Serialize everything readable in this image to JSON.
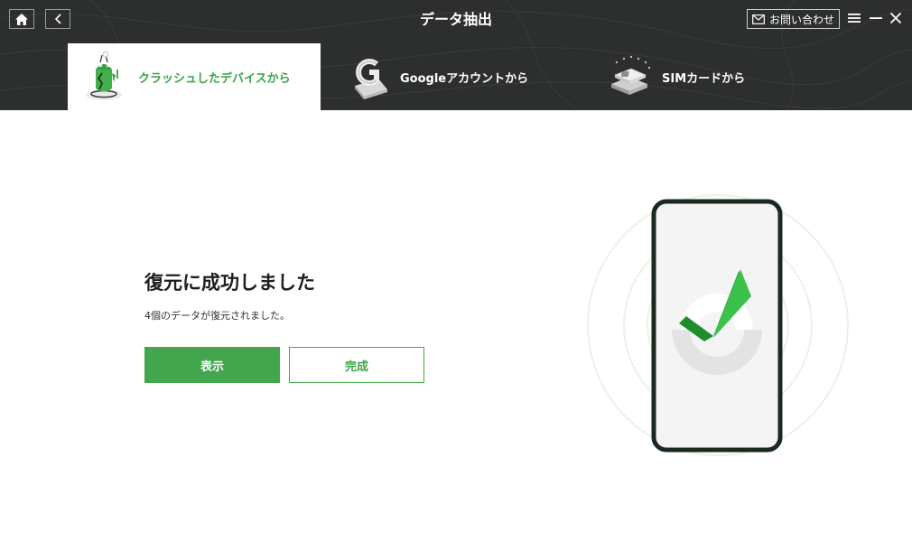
{
  "window": {
    "title": "データ抽出"
  },
  "header": {
    "contact_label": "お問い合わせ",
    "accent_color": "#3aa346",
    "background_color": "#2d2f2f"
  },
  "tabs": [
    {
      "label": "クラッシュしたデバイスから",
      "icon": "crashed-android-icon",
      "active": true
    },
    {
      "label": "Googleアカウントから",
      "icon": "google-account-icon",
      "active": false
    },
    {
      "label": "SIMカードから",
      "icon": "sim-card-icon",
      "active": false
    }
  ],
  "result": {
    "title": "復元に成功しました",
    "subtitle": "4個のデータが復元されました。",
    "view_button": "表示",
    "done_button": "完成"
  },
  "icons": {
    "home": "home-icon",
    "back": "back-arrow-icon",
    "mail": "mail-icon",
    "menu": "menu-icon",
    "minimize": "minimize-icon",
    "close": "close-icon",
    "success": "checkmark-icon",
    "phone": "phone-icon"
  }
}
